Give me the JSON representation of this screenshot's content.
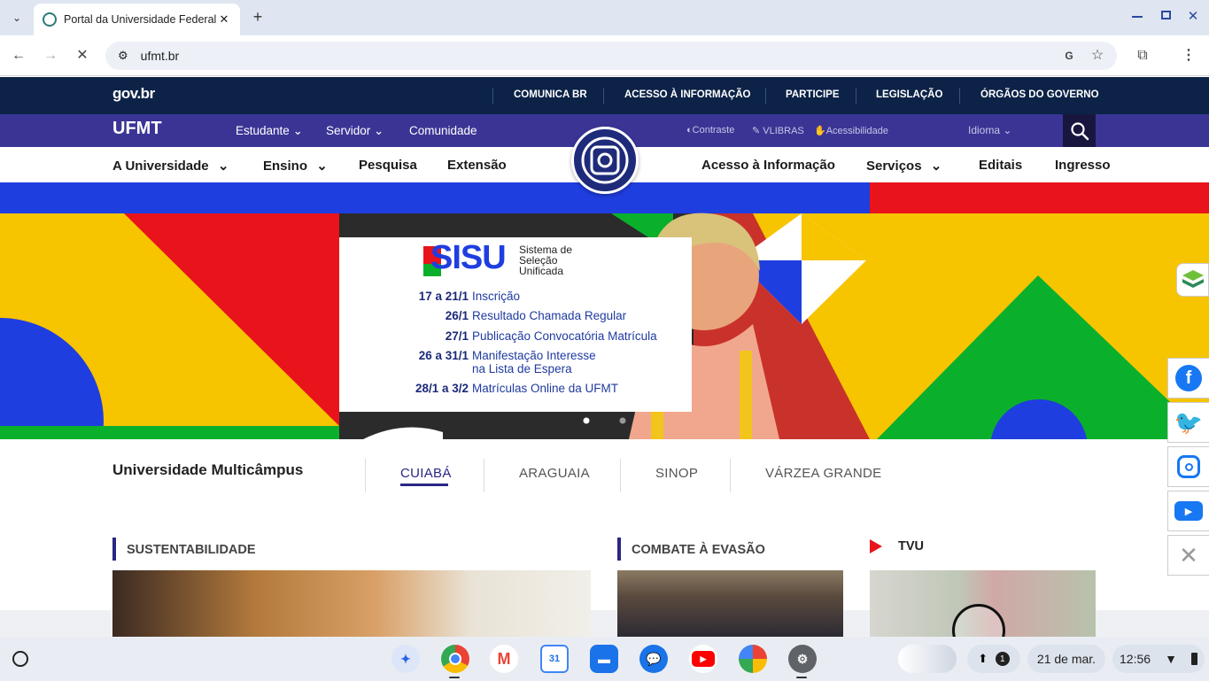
{
  "browser": {
    "tab_title": "Portal da Universidade Federal",
    "tab_close": "✕",
    "new_tab": "+",
    "url": "ufmt.br",
    "window_controls": [
      "minimize-icon",
      "restore-icon",
      "close-icon"
    ]
  },
  "govbr": {
    "logo": "gov.br",
    "links": [
      "COMUNICA BR",
      "ACESSO À INFORMAÇÃO",
      "PARTICIPE",
      "LEGISLAÇÃO",
      "ÓRGÃOS DO GOVERNO"
    ]
  },
  "ufmt_bar": {
    "logo": "UFMT",
    "nav": [
      "Estudante",
      "Servidor",
      "Comunidade"
    ],
    "contrast": "Contraste",
    "vlibras": "VLIBRAS",
    "accessibility": "Acessibilidade",
    "language": "Idioma"
  },
  "main_nav": {
    "left": [
      "A Universidade",
      "Ensino",
      "Pesquisa",
      "Extensão"
    ],
    "right": [
      "Acesso à Informação",
      "Serviços",
      "Editais",
      "Ingresso"
    ]
  },
  "banner": {
    "logo_text": "SISU",
    "logo_sub1": "Sistema de",
    "logo_sub2": "Seleção",
    "logo_sub3": "Unificada",
    "rows": [
      {
        "date": "17 a 21/1",
        "text": "Inscrição"
      },
      {
        "date": "26/1",
        "text": "Resultado Chamada Regular"
      },
      {
        "date": "27/1",
        "text": "Publicação Convocatória Matrícula"
      },
      {
        "date": "26 a 31/1",
        "text": "Manifestação Interesse",
        "text2": "na Lista de Espera"
      },
      {
        "date": "28/1 a 3/2",
        "text": "Matrículas Online da UFMT"
      }
    ]
  },
  "campus": {
    "title": "Universidade Multicâmpus",
    "tabs": [
      "CUIABÁ",
      "ARAGUAIA",
      "SINOP",
      "VÁRZEA GRANDE"
    ],
    "active": "CUIABÁ"
  },
  "sections": {
    "s1": "SUSTENTABILIDADE",
    "s2": "COMBATE À EVASÃO",
    "s3": "TVU"
  },
  "shelf": {
    "date": "21 de mar.",
    "time": "12:56",
    "notif_count": "1"
  },
  "colors": {
    "govbar": "#0c2247",
    "ufmtbar": "#3a3595",
    "accent_yellow": "#f7c400",
    "accent_blue": "#1f3ee0",
    "accent_red": "#e8131b",
    "accent_green": "#0ab02b"
  }
}
